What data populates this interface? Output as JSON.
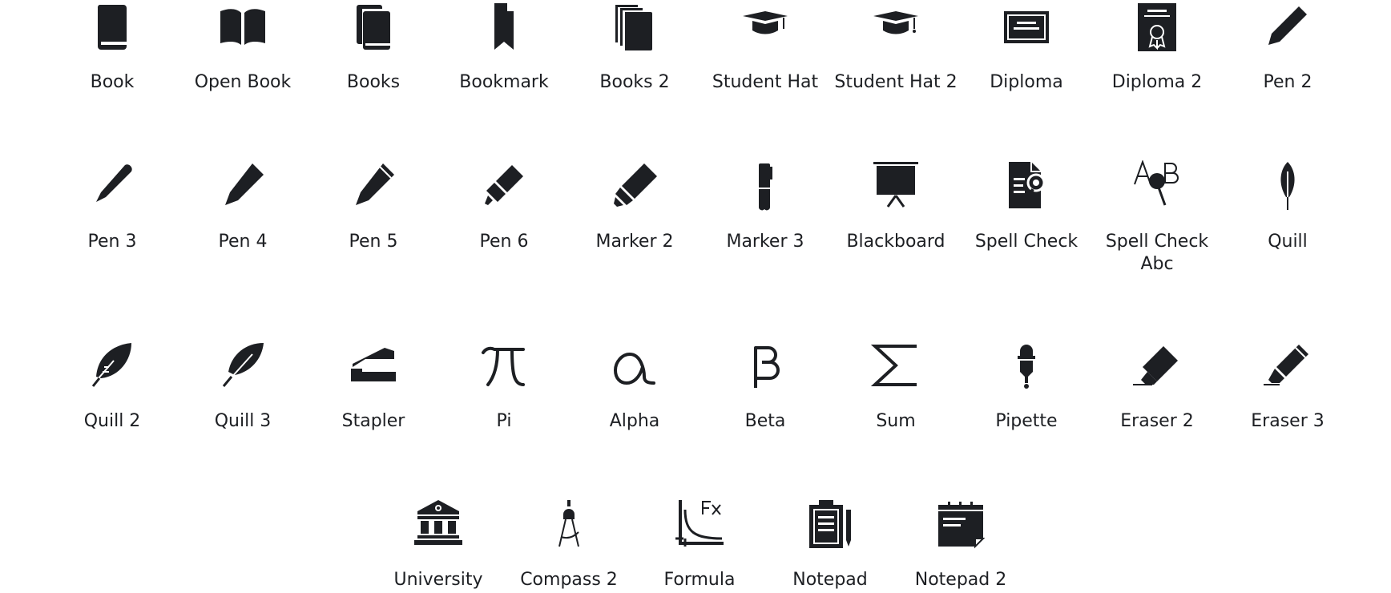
{
  "colors": {
    "icon": "#1d1f23",
    "background": "#ffffff"
  },
  "rows": [
    {
      "items": [
        {
          "label": "Book",
          "icon": "book-icon"
        },
        {
          "label": "Open Book",
          "icon": "open-book-icon"
        },
        {
          "label": "Books",
          "icon": "books-icon"
        },
        {
          "label": "Bookmark",
          "icon": "bookmark-icon"
        },
        {
          "label": "Books 2",
          "icon": "books-2-icon"
        },
        {
          "label": "Student Hat",
          "icon": "student-hat-icon"
        },
        {
          "label": "Student Hat 2",
          "icon": "student-hat-2-icon"
        },
        {
          "label": "Diploma",
          "icon": "diploma-icon"
        },
        {
          "label": "Diploma 2",
          "icon": "diploma-2-icon"
        },
        {
          "label": "Pen 2",
          "icon": "pen-2-icon"
        }
      ]
    },
    {
      "items": [
        {
          "label": "Pen 3",
          "icon": "pen-3-icon"
        },
        {
          "label": "Pen 4",
          "icon": "pen-4-icon"
        },
        {
          "label": "Pen 5",
          "icon": "pen-5-icon"
        },
        {
          "label": "Pen 6",
          "icon": "pen-6-icon"
        },
        {
          "label": "Marker 2",
          "icon": "marker-2-icon"
        },
        {
          "label": "Marker 3",
          "icon": "marker-3-icon"
        },
        {
          "label": "Blackboard",
          "icon": "blackboard-icon"
        },
        {
          "label": "Spell Check",
          "icon": "spell-check-icon"
        },
        {
          "label": "Spell Check Abc",
          "icon": "spell-check-abc-icon"
        },
        {
          "label": "Quill",
          "icon": "quill-icon"
        }
      ]
    },
    {
      "items": [
        {
          "label": "Quill 2",
          "icon": "quill-2-icon"
        },
        {
          "label": "Quill 3",
          "icon": "quill-3-icon"
        },
        {
          "label": "Stapler",
          "icon": "stapler-icon"
        },
        {
          "label": "Pi",
          "icon": "pi-icon"
        },
        {
          "label": "Alpha",
          "icon": "alpha-icon"
        },
        {
          "label": "Beta",
          "icon": "beta-icon"
        },
        {
          "label": "Sum",
          "icon": "sum-icon"
        },
        {
          "label": "Pipette",
          "icon": "pipette-icon"
        },
        {
          "label": "Eraser 2",
          "icon": "eraser-2-icon"
        },
        {
          "label": "Eraser 3",
          "icon": "eraser-3-icon"
        }
      ]
    },
    {
      "items": [
        {
          "label": "University",
          "icon": "university-icon"
        },
        {
          "label": "Compass 2",
          "icon": "compass-2-icon"
        },
        {
          "label": "Formula",
          "icon": "formula-icon"
        },
        {
          "label": "Notepad",
          "icon": "notepad-icon"
        },
        {
          "label": "Notepad 2",
          "icon": "notepad-2-icon"
        }
      ]
    }
  ]
}
